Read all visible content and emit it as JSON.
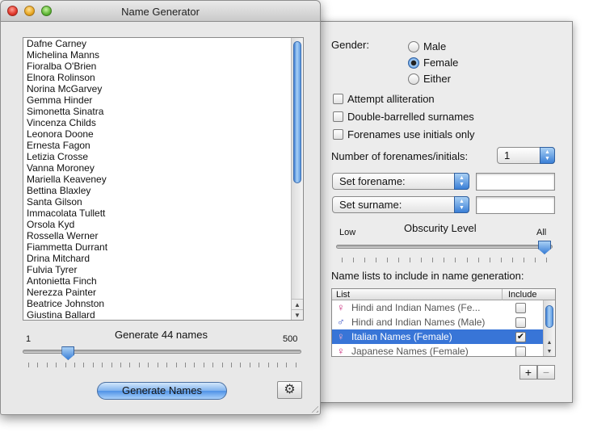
{
  "window": {
    "title": "Name Generator"
  },
  "names": [
    "Dafne Carney",
    "Michelina Manns",
    "Fioralba O'Brien",
    "Elnora Rolinson",
    "Norina McGarvey",
    "Gemma Hinder",
    "Simonetta Sinatra",
    "Vincenza Childs",
    "Leonora Doone",
    "Ernesta Fagon",
    "Letizia Crosse",
    "Vanna Moroney",
    "Mariella Keaveney",
    "Bettina Blaxley",
    "Santa Gilson",
    "Immacolata Tullett",
    "Orsola Kyd",
    "Rossella Werner",
    "Fiammetta Durrant",
    "Drina Mitchard",
    "Fulvia Tyrer",
    "Antonietta Finch",
    "Nerezza Painter",
    "Beatrice Johnston",
    "Giustina Ballard"
  ],
  "count_slider": {
    "min_label": "1",
    "max_label": "500",
    "caption": "Generate 44 names",
    "value": 44,
    "min": 1,
    "max": 500
  },
  "generate_button": "Generate Names",
  "options": {
    "gender_label": "Gender:",
    "gender_options": [
      {
        "label": "Male",
        "selected": false
      },
      {
        "label": "Female",
        "selected": true
      },
      {
        "label": "Either",
        "selected": false
      }
    ],
    "checkboxes": [
      {
        "label": "Attempt alliteration",
        "checked": false
      },
      {
        "label": "Double-barrelled surnames",
        "checked": false
      },
      {
        "label": "Forenames use initials only",
        "checked": false
      }
    ],
    "forenames_count_label": "Number of forenames/initials:",
    "forenames_count_value": "1",
    "forename_popup": "Set forename:",
    "forename_value": "",
    "surname_popup": "Set surname:",
    "surname_value": "",
    "obscurity": {
      "caption": "Obscurity Level",
      "low_label": "Low",
      "high_label": "All",
      "level": "All"
    },
    "lists_label": "Name lists to include in name generation:",
    "table": {
      "col_list": "List",
      "col_include": "Include",
      "rows": [
        {
          "icon": "female-icon",
          "symbol": "♀",
          "name": "Hindi and Indian Names (Fe...",
          "include": false,
          "selected": false
        },
        {
          "icon": "male-icon",
          "symbol": "♂",
          "name": "Hindi and Indian Names (Male)",
          "include": false,
          "selected": false
        },
        {
          "icon": "female-icon",
          "symbol": "♀",
          "name": "Italian Names (Female)",
          "include": true,
          "selected": true
        },
        {
          "icon": "female-icon",
          "symbol": "♀",
          "name": "Japanese Names (Female)",
          "include": false,
          "selected": false
        }
      ]
    },
    "add_label": "+",
    "remove_label": "−"
  },
  "colors": {
    "female": "#c8287a",
    "male": "#3a52c4",
    "selection": "#3875d7"
  }
}
